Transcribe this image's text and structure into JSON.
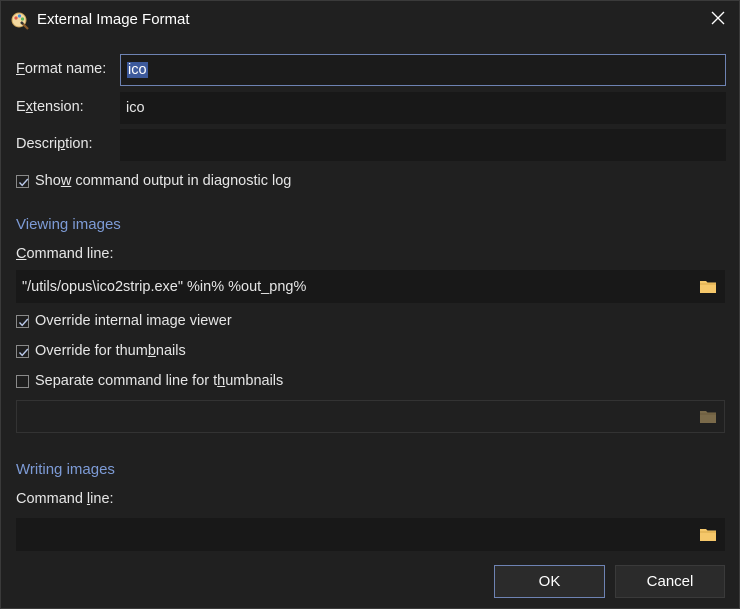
{
  "window": {
    "title": "External Image Format"
  },
  "fields": {
    "format_name_label_pre": "",
    "format_name_label_acc": "F",
    "format_name_label_post": "ormat name:",
    "format_name_value": "ico",
    "extension_label_pre": "E",
    "extension_label_acc": "x",
    "extension_label_post": "tension:",
    "extension_value": "ico",
    "description_label_pre": "Descri",
    "description_label_acc": "p",
    "description_label_post": "tion:",
    "description_value": ""
  },
  "show_output": {
    "pre": "Sho",
    "acc": "w",
    "post": " command output in diagnostic log",
    "checked": true
  },
  "viewing": {
    "section_title": "Viewing images",
    "cmd_label_pre": "",
    "cmd_label_acc": "C",
    "cmd_label_post": "ommand line:",
    "cmd_value": "\"/utils/opus\\ico2strip.exe\" %in% %out_png%",
    "override_viewer": {
      "pre": "Override internal ima",
      "acc": "g",
      "post": "e viewer",
      "checked": true
    },
    "override_thumbs": {
      "pre": "Override for thum",
      "acc": "b",
      "post": "nails",
      "checked": true
    },
    "separate_cmd": {
      "pre": "Separate command line for t",
      "acc": "h",
      "post": "umbnails",
      "checked": false
    },
    "thumb_cmd_value": ""
  },
  "writing": {
    "section_title": "Writing images",
    "cmd_label_pre": "Command ",
    "cmd_label_acc": "l",
    "cmd_label_post": "ine:",
    "cmd_value": ""
  },
  "buttons": {
    "ok": "OK",
    "cancel": "Cancel"
  },
  "icons": {
    "app": "format-palette-icon",
    "close": "close-icon",
    "folder": "folder-icon"
  },
  "colors": {
    "accent": "#7d9bd6",
    "focus_border": "#6e83b3",
    "selection": "#3d5a9c",
    "folder": "#f5c76a"
  }
}
